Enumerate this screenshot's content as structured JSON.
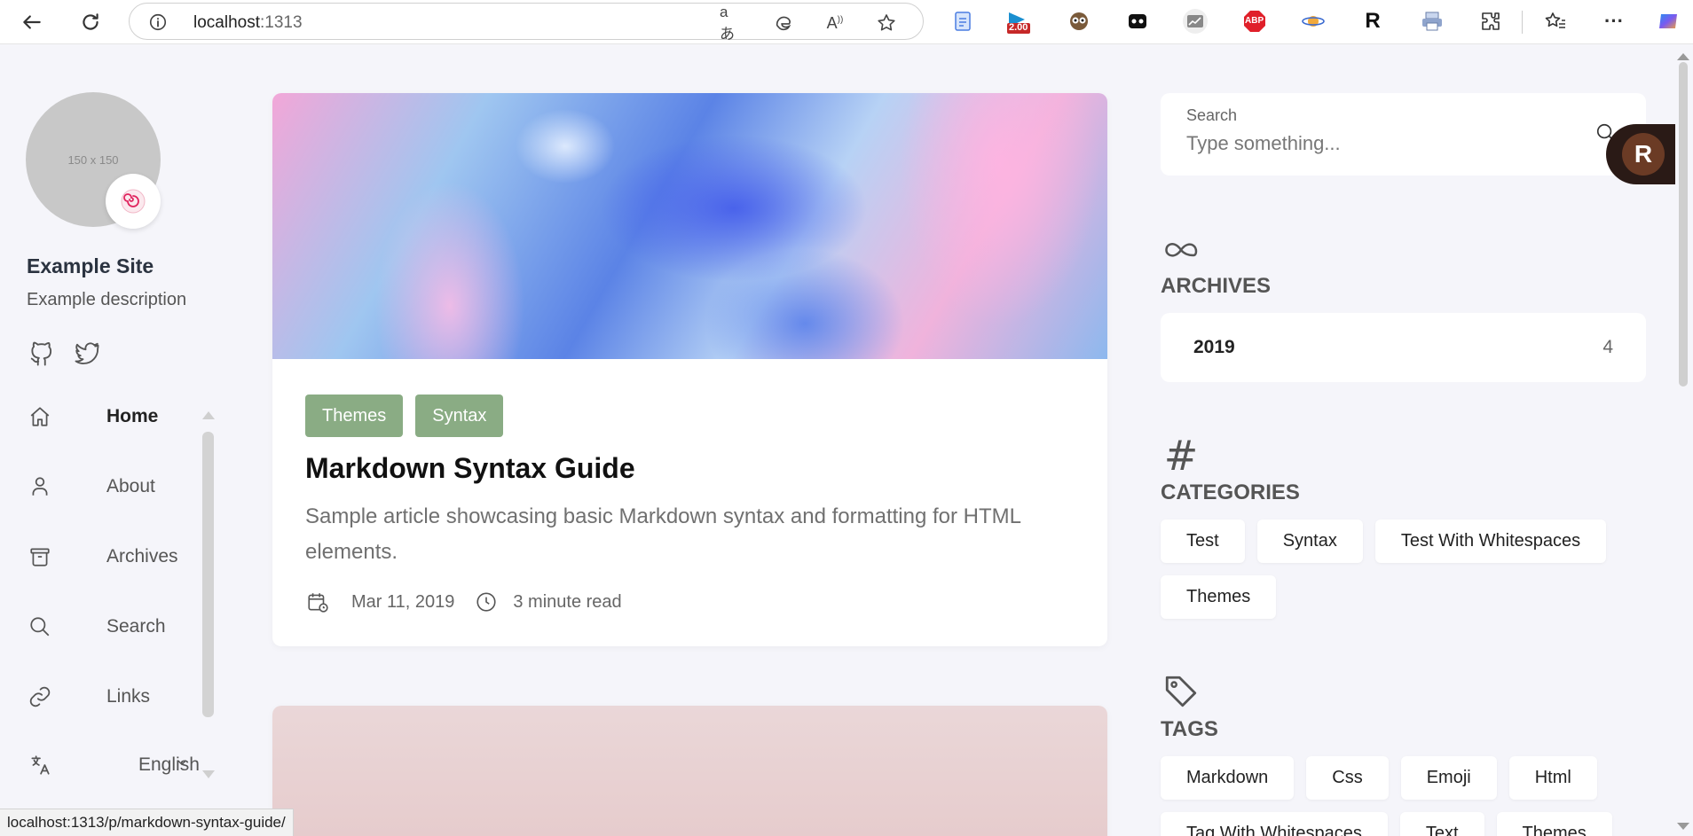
{
  "browser": {
    "host": "localhost",
    "port": ":1313",
    "extensions": [
      {
        "name": "docs-icon",
        "label": ""
      },
      {
        "name": "flag-counter-icon",
        "label": "2.00"
      },
      {
        "name": "owl-icon",
        "label": ""
      },
      {
        "name": "bear-icon",
        "label": ""
      },
      {
        "name": "graph-icon",
        "label": ""
      },
      {
        "name": "adblock-icon",
        "label": "ABP"
      },
      {
        "name": "planet-icon",
        "label": ""
      },
      {
        "name": "r-extension-icon",
        "label": "R"
      },
      {
        "name": "printer-icon",
        "label": ""
      },
      {
        "name": "puzzle-icon",
        "label": ""
      }
    ]
  },
  "sidebar": {
    "avatar_placeholder": "150 x 150",
    "site_name": "Example Site",
    "site_description": "Example description",
    "menu": [
      {
        "label": "Home",
        "icon": "home-icon",
        "active": true
      },
      {
        "label": "About",
        "icon": "user-icon",
        "active": false
      },
      {
        "label": "Archives",
        "icon": "archive-icon",
        "active": false
      },
      {
        "label": "Search",
        "icon": "search-icon",
        "active": false
      },
      {
        "label": "Links",
        "icon": "link-icon",
        "active": false
      }
    ],
    "language": "English"
  },
  "articles": [
    {
      "tags": [
        "Themes",
        "Syntax"
      ],
      "title": "Markdown Syntax Guide",
      "description": "Sample article showcasing basic Markdown syntax and formatting for HTML elements.",
      "date": "Mar 11, 2019",
      "read_time": "3 minute read"
    }
  ],
  "search": {
    "label": "Search",
    "placeholder": "Type something..."
  },
  "archives": {
    "title": "ARCHIVES",
    "items": [
      {
        "year": "2019",
        "count": "4"
      }
    ]
  },
  "categories": {
    "title": "CATEGORIES",
    "items": [
      "Test",
      "Syntax",
      "Test With Whitespaces",
      "Themes"
    ]
  },
  "tags": {
    "title": "TAGS",
    "items": [
      "Markdown",
      "Css",
      "Emoji",
      "Html",
      "Tag With Whitespaces",
      "Text",
      "Themes"
    ]
  },
  "status_url": "localhost:1313/p/markdown-syntax-guide/",
  "colors": {
    "tag_bg": "#8aac84",
    "page_bg": "#f5f5fa"
  }
}
